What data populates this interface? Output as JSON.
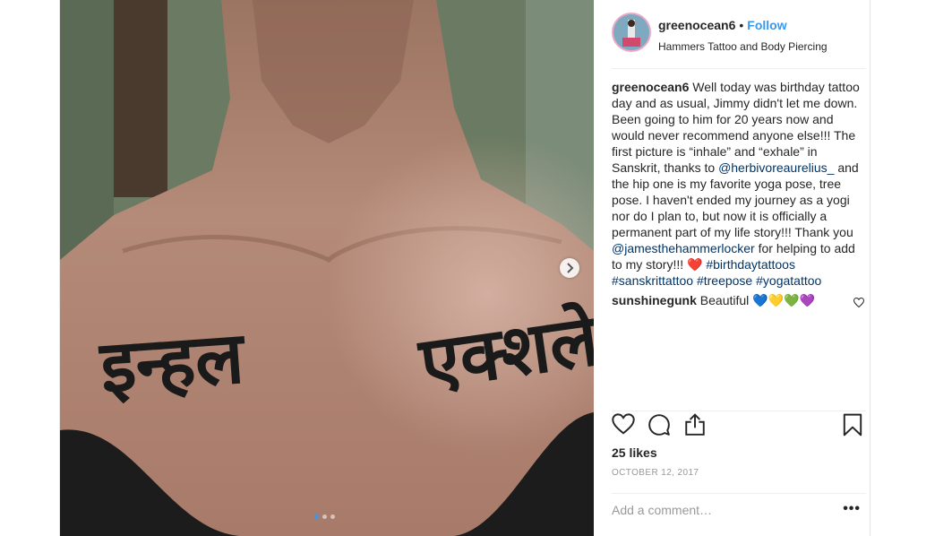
{
  "post": {
    "username": "greenocean6",
    "separator": "•",
    "follow_label": "Follow",
    "location": "Hammers Tattoo and Body Piercing",
    "caption": {
      "username": "greenocean6",
      "text_1": " Well today was birthday tattoo day and as usual, Jimmy didn't let me down. Been going to him for 20 years now and would never recommend anyone else!!! The first picture is “inhale” and “exhale” in Sanskrit, thanks to ",
      "mention_1": "@herbivoreaurelius_",
      "text_2": " and the hip one is my favorite yoga pose, tree pose. I haven't ended my journey as a yogi nor do I plan to, but now it is officially a permanent part of my life story!!! Thank you ",
      "mention_2": "@jamesthehammerlocker",
      "text_3": " for helping to add to my story!!! ❤️ ",
      "hashtag_1": "#birthdaytattoos",
      "hashtag_2": "#sanskrittattoo",
      "hashtag_3": "#treepose",
      "hashtag_4": "#yogatattoo"
    },
    "comment": {
      "username": "sunshinegunk",
      "text": " Beautiful 💙💛💚💜"
    },
    "likes": "25 likes",
    "date": "OCTOBER 12, 2017",
    "comment_placeholder": "Add a comment…",
    "more_label": "•••"
  },
  "photo": {
    "tattoo_left": "इन्हल",
    "tattoo_right": "एक्शले",
    "carousel_total": 3,
    "carousel_active": 1
  },
  "icons": {
    "like": "heart-icon",
    "comment": "comment-icon",
    "share": "share-icon",
    "save": "bookmark-icon",
    "next": "chevron-right-icon"
  },
  "colors": {
    "accent": "#3897f0",
    "link": "#003569",
    "muted": "#999999"
  }
}
